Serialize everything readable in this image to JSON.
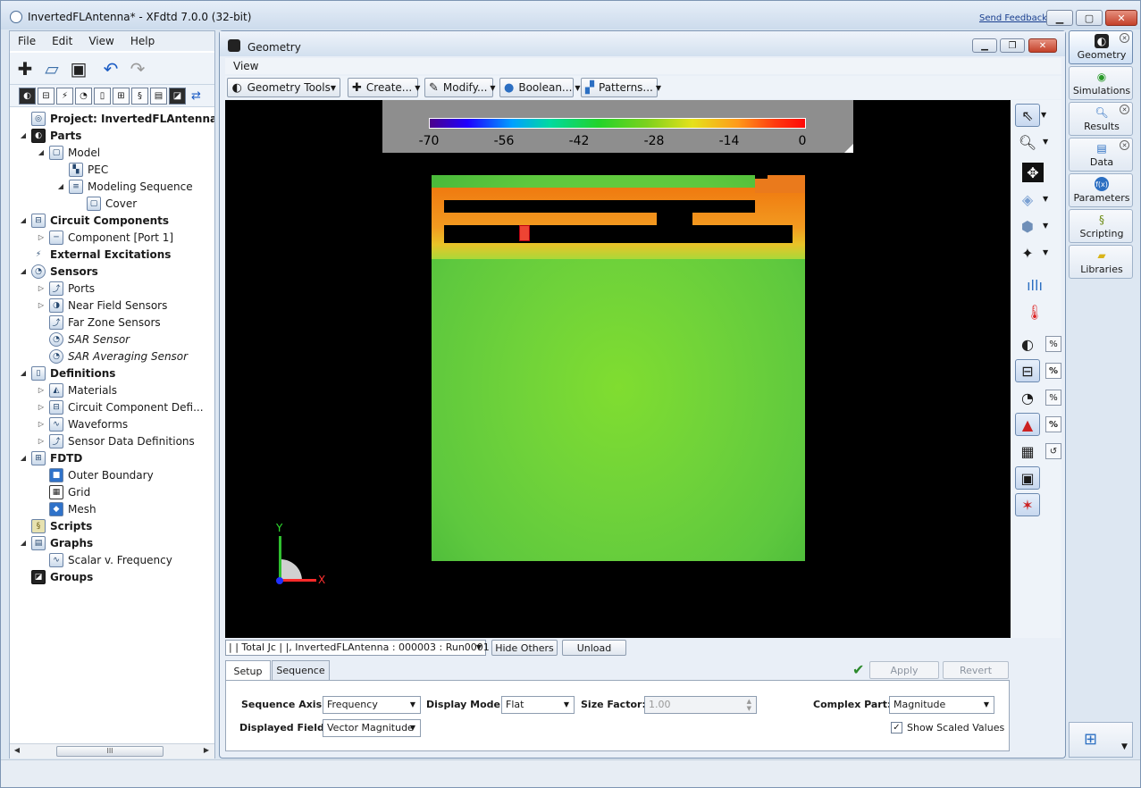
{
  "window": {
    "title": "InvertedFLAntenna* - XFdtd 7.0.0 (32-bit)",
    "send_feedback": "Send Feedback"
  },
  "menu": [
    "File",
    "Edit",
    "View",
    "Help"
  ],
  "tree": [
    {
      "label": "Project: InvertedFLAntenna",
      "level": 0,
      "bold": true,
      "expand": ""
    },
    {
      "label": "Parts",
      "level": 0,
      "bold": true,
      "expand": "◢"
    },
    {
      "label": "Model",
      "level": 1,
      "expand": "◢"
    },
    {
      "label": "PEC",
      "level": 2,
      "expand": ""
    },
    {
      "label": "Modeling Sequence",
      "level": 2,
      "expand": "◢"
    },
    {
      "label": "Cover",
      "level": 3,
      "expand": ""
    },
    {
      "label": "Circuit Components",
      "level": 0,
      "bold": true,
      "expand": "◢"
    },
    {
      "label": "Component [Port 1]",
      "level": 1,
      "expand": "▷"
    },
    {
      "label": "External Excitations",
      "level": 0,
      "bold": true,
      "expand": ""
    },
    {
      "label": "Sensors",
      "level": 0,
      "bold": true,
      "expand": "◢"
    },
    {
      "label": "Ports",
      "level": 1,
      "expand": "▷"
    },
    {
      "label": "Near Field Sensors",
      "level": 1,
      "expand": "▷"
    },
    {
      "label": "Far Zone Sensors",
      "level": 1,
      "expand": ""
    },
    {
      "label": "SAR Sensor",
      "level": 1,
      "italic": true,
      "expand": ""
    },
    {
      "label": "SAR Averaging Sensor",
      "level": 1,
      "italic": true,
      "expand": ""
    },
    {
      "label": "Definitions",
      "level": 0,
      "bold": true,
      "expand": "◢"
    },
    {
      "label": "Materials",
      "level": 1,
      "expand": "▷"
    },
    {
      "label": "Circuit Component Defi...",
      "level": 1,
      "expand": "▷"
    },
    {
      "label": "Waveforms",
      "level": 1,
      "expand": "▷"
    },
    {
      "label": "Sensor Data Definitions",
      "level": 1,
      "expand": "▷"
    },
    {
      "label": "FDTD",
      "level": 0,
      "bold": true,
      "expand": "◢"
    },
    {
      "label": "Outer Boundary",
      "level": 1,
      "expand": ""
    },
    {
      "label": "Grid",
      "level": 1,
      "expand": ""
    },
    {
      "label": "Mesh",
      "level": 1,
      "expand": ""
    },
    {
      "label": "Scripts",
      "level": 0,
      "bold": true,
      "expand": ""
    },
    {
      "label": "Graphs",
      "level": 0,
      "bold": true,
      "expand": "◢"
    },
    {
      "label": "Scalar v. Frequency",
      "level": 1,
      "expand": ""
    },
    {
      "label": "Groups",
      "level": 0,
      "bold": true,
      "expand": ""
    }
  ],
  "hscroll_thumb": "III",
  "geometry": {
    "title": "Geometry",
    "view_menu": "View",
    "toolbar": {
      "tools": "Geometry Tools",
      "create": "Create...",
      "modify": "Modify...",
      "boolean": "Boolean...",
      "patterns": "Patterns..."
    },
    "legend_ticks": [
      "-70",
      "-56",
      "-42",
      "-28",
      "-14",
      "0"
    ],
    "axis_y": "Y",
    "axis_x": "X",
    "result_select": "| | Total  Jc | |, InvertedFLAntenna : 000003 : Run0001",
    "hide_others": "Hide Others",
    "unload": "Unload",
    "tabs": {
      "setup": "Setup",
      "sequence": "Sequence"
    },
    "apply": "Apply",
    "revert": "Revert",
    "sequence_axis_label": "Sequence Axis:",
    "sequence_axis_value": "Frequency",
    "display_mode_label": "Display Mode:",
    "display_mode_value": "Flat",
    "size_factor_label": "Size Factor:",
    "size_factor_value": "1.00",
    "complex_part_label": "Complex Part:",
    "complex_part_value": "Magnitude",
    "displayed_field_label": "Displayed Field:",
    "displayed_field_value": "Vector Magnitude",
    "show_scaled_label": "Show Scaled Values",
    "show_scaled_checked": true,
    "pct": "%"
  },
  "right_tabs": [
    "Geometry",
    "Simulations",
    "Results",
    "Data",
    "Parameters",
    "Scripting",
    "Libraries"
  ]
}
